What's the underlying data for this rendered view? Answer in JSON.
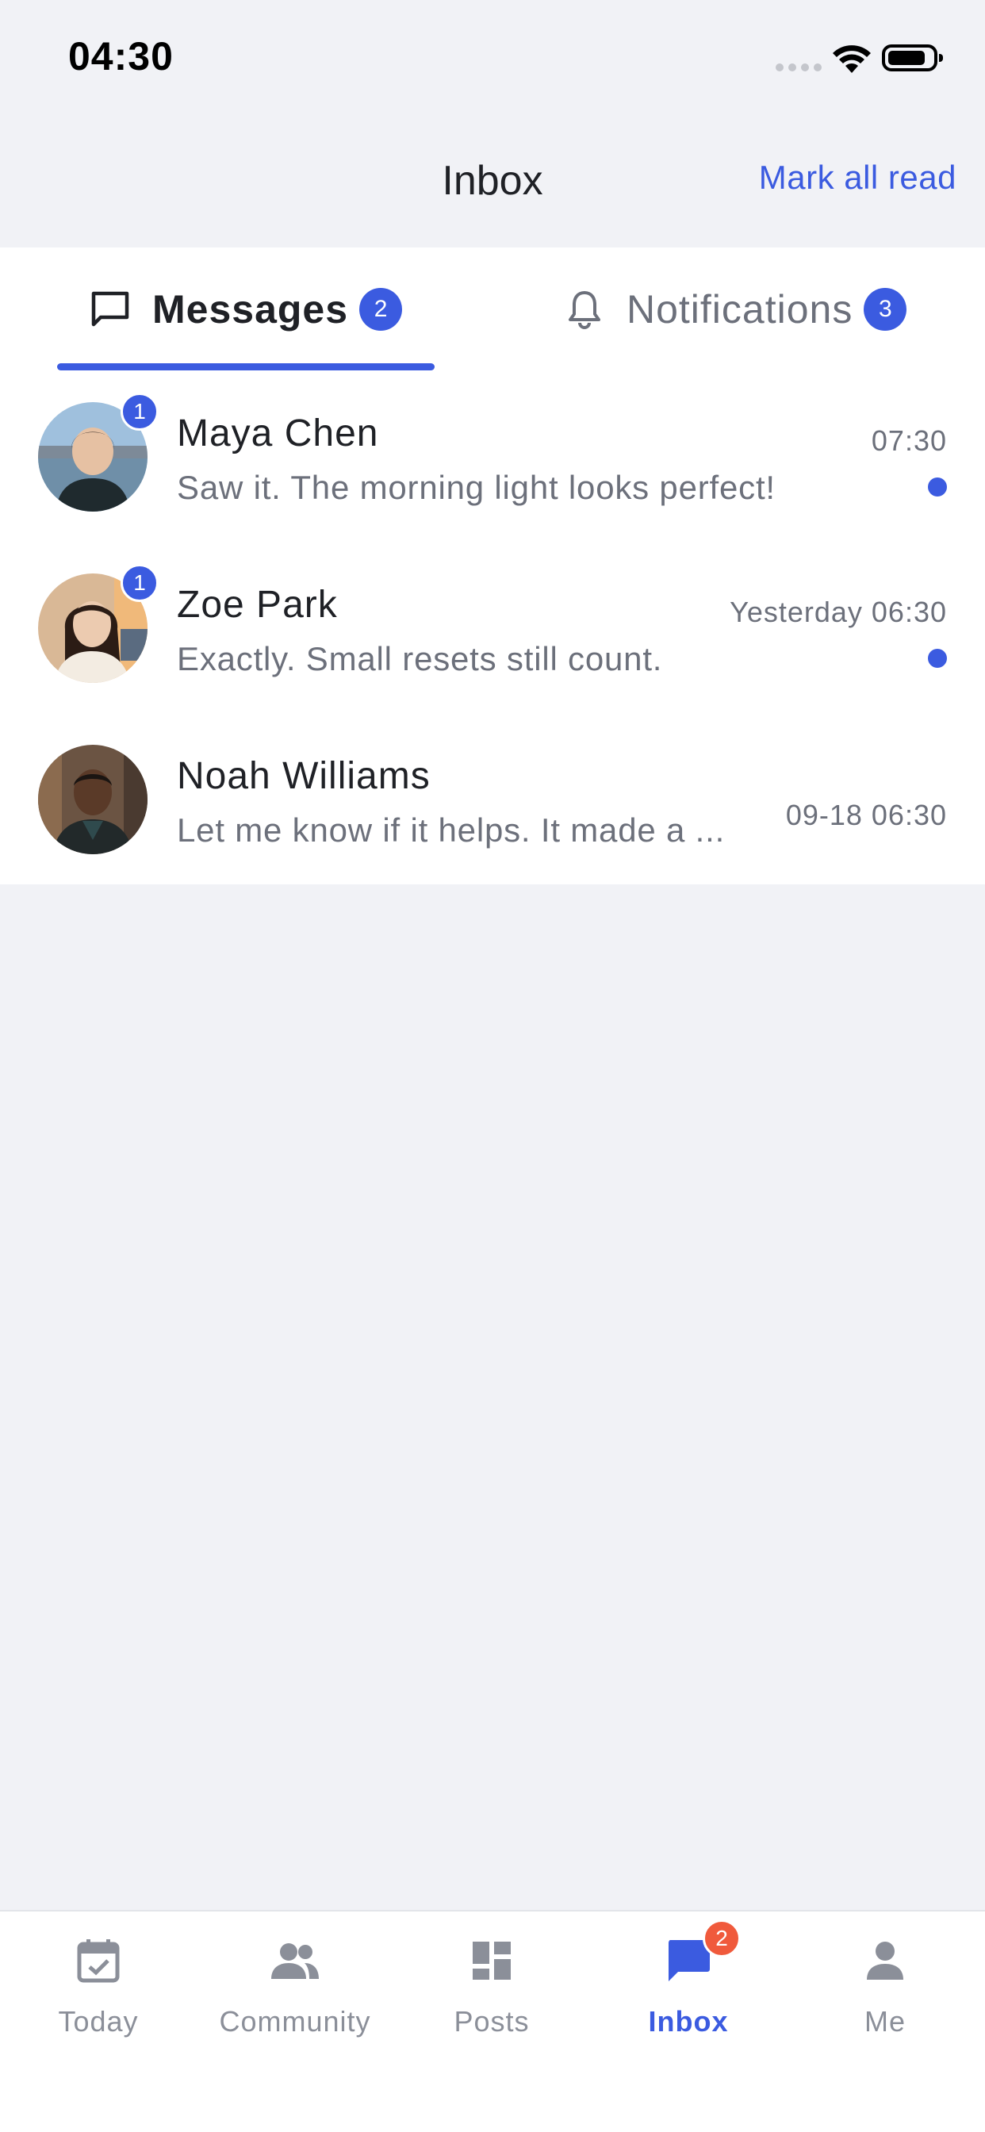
{
  "status_bar": {
    "time": "04:30",
    "icons": [
      "signal-icon",
      "wifi-icon",
      "battery-icon"
    ]
  },
  "header": {
    "title": "Inbox",
    "action_label": "Mark all read"
  },
  "tabs": [
    {
      "label": "Messages",
      "badge": "2",
      "icon": "chat-icon",
      "active": true
    },
    {
      "label": "Notifications",
      "badge": "3",
      "icon": "bell-icon",
      "active": false
    }
  ],
  "conversations": [
    {
      "name": "Maya Chen",
      "preview": "Saw it. The morning light looks perfect!",
      "time": "07:30",
      "unread_count": "1",
      "unread": true,
      "avatar": "avatar-maya"
    },
    {
      "name": "Zoe Park",
      "preview": "Exactly. Small resets still count.",
      "time": "Yesterday 06:30",
      "unread_count": "1",
      "unread": true,
      "avatar": "avatar-zoe"
    },
    {
      "name": "Noah Williams",
      "preview": "Let me know if it helps. It made a ...",
      "time": "09-18 06:30",
      "unread": false,
      "avatar": "avatar-noah"
    }
  ],
  "bottom_nav": [
    {
      "label": "Today",
      "icon": "calendar-check-icon",
      "active": false
    },
    {
      "label": "Community",
      "icon": "people-icon",
      "active": false
    },
    {
      "label": "Posts",
      "icon": "dashboard-icon",
      "active": false
    },
    {
      "label": "Inbox",
      "icon": "chat-bubble-icon",
      "active": true,
      "badge": "2"
    },
    {
      "label": "Me",
      "icon": "person-icon",
      "active": false
    }
  ],
  "colors": {
    "accent": "#3b5be0",
    "badge_alert": "#f05a3c",
    "background": "#f1f2f6",
    "text_primary": "#1f2126",
    "text_secondary": "#6c707b"
  }
}
